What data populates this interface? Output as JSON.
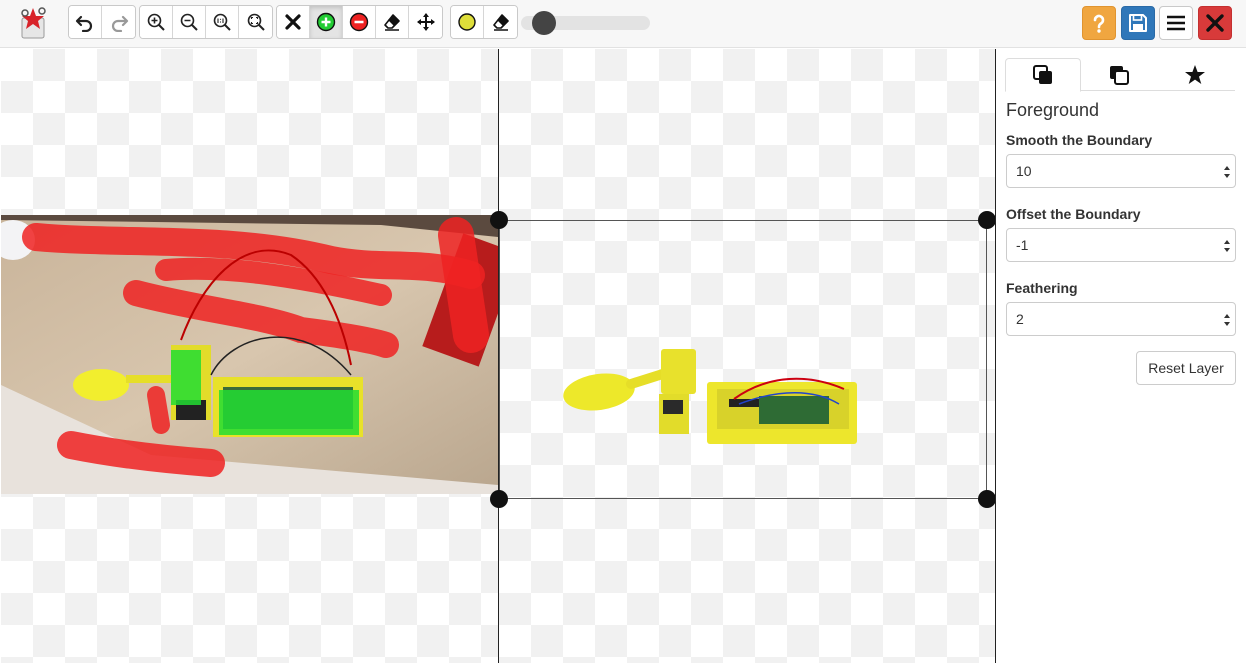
{
  "toolbar": {
    "logo": "app-logo-icon",
    "history": [
      "undo-icon",
      "redo-icon"
    ],
    "zoom": [
      "zoom-in-icon",
      "zoom-out-icon",
      "zoom-actual-size-icon",
      "zoom-fit-icon"
    ],
    "edit": [
      "clear-icon",
      "mark-foreground-icon",
      "mark-background-icon",
      "eraser-icon",
      "move-icon"
    ],
    "brush": [
      "brush-color-icon",
      "brush-eraser-icon"
    ],
    "brush_size": 0.1,
    "right": [
      "help-icon",
      "save-icon",
      "menu-icon",
      "close-icon"
    ]
  },
  "colors": {
    "foreground_mark": "#22cc33",
    "background_mark": "#ee2222",
    "help": "#f0a640",
    "save": "#2f77b9",
    "close": "#d83a3a"
  },
  "panel": {
    "tabs": [
      "foreground-layer-icon",
      "background-layer-icon",
      "favorite-icon"
    ],
    "active_tab": 0,
    "title": "Foreground",
    "smooth_label": "Smooth the Boundary",
    "smooth_value": "10",
    "offset_label": "Offset the Boundary",
    "offset_value": "-1",
    "feather_label": "Feathering",
    "feather_value": "2",
    "reset_label": "Reset Layer"
  }
}
